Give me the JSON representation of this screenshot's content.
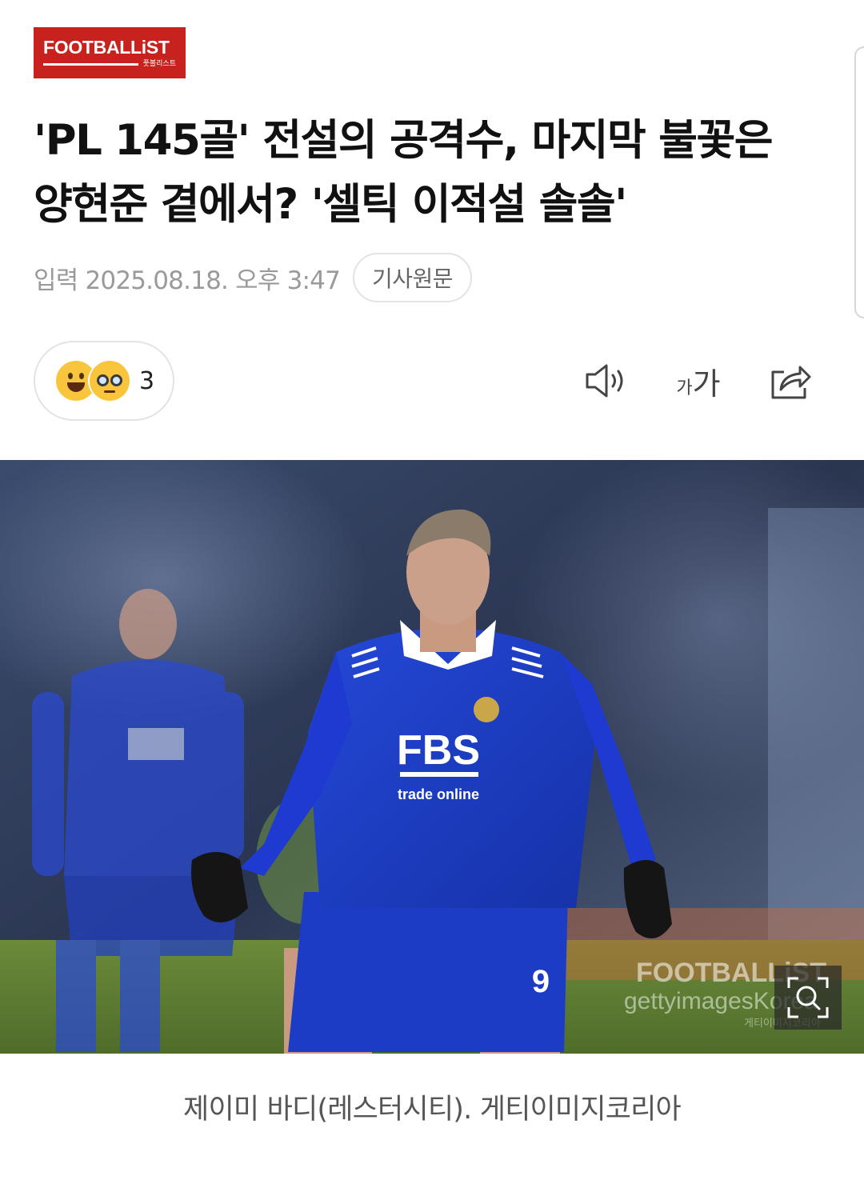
{
  "brand": {
    "name": "FOOTBALLiST",
    "sub": "풋볼리스트",
    "color": "#c8221f"
  },
  "article": {
    "title_line1": "'PL 145골' 전설의 공격수, 마지막 불꽃은",
    "title_line2": "양현준 곁에서? '셀틱 이적설 솔솔'",
    "date": "입력 2025.08.18. 오후 3:47",
    "source_button": "기사원문"
  },
  "reactions": {
    "icons": [
      "smile-emoji",
      "glasses-emoji"
    ],
    "count": "3"
  },
  "toolbar": {
    "font_small": "가",
    "font_big": "가",
    "icons": [
      "speaker-icon",
      "font-size-icon",
      "share-icon"
    ]
  },
  "photo": {
    "shirt_sponsor": "FBS",
    "shirt_sponsor_sub": "trade online",
    "shirt_number": "9",
    "watermark_brand": "FOOTBALLiST",
    "watermark_agency": "gettyimagesKorea",
    "watermark_sub": "게티이미지코리아",
    "kit_color": "#1c3fd0"
  },
  "caption": "제이미 바디(레스터시티). 게티이미지코리아"
}
